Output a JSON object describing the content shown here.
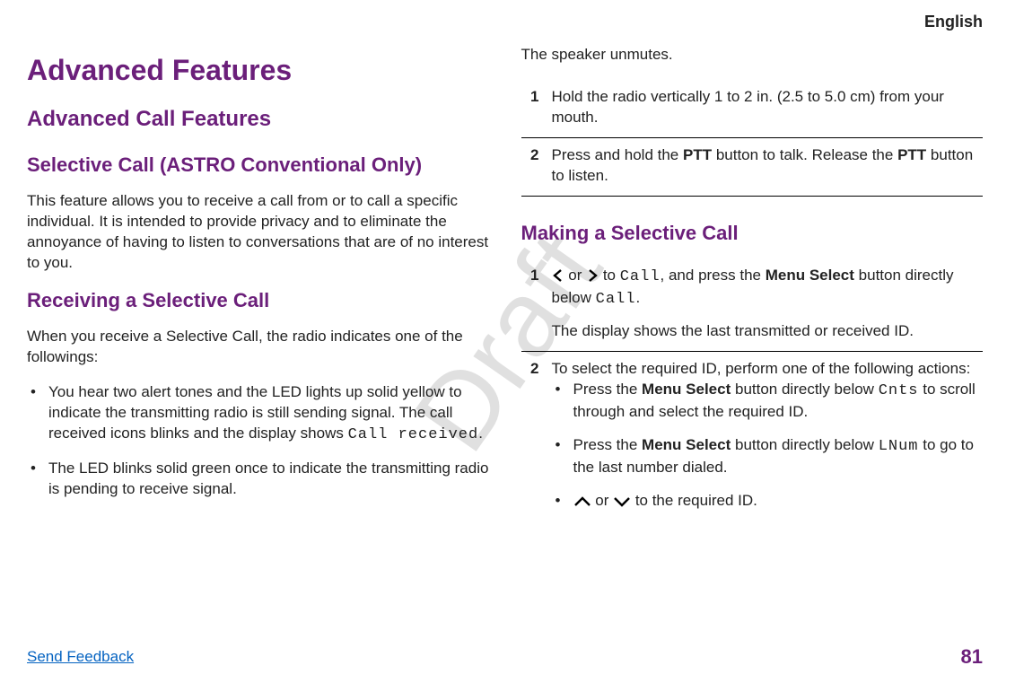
{
  "watermark": "Draft",
  "header": {
    "language": "English"
  },
  "left": {
    "h1": "Advanced Features",
    "h2": "Advanced Call Features",
    "h3a": "Selective Call (ASTRO Conventional Only)",
    "p1": "This feature allows you to receive a call from or to call a specific individual. It is intended to provide privacy and to eliminate the annoyance of having to listen to conversations that are of no interest to you.",
    "h3b": "Receiving a Selective Call",
    "p2": "When you receive a Selective Call, the radio indicates one of the followings:",
    "bullets": [
      {
        "a": "You hear two alert tones and the LED lights up solid yellow to indicate the transmitting radio is still sending signal. The call received icons blinks and the display shows ",
        "mono": "Call received",
        "b": "."
      },
      {
        "a": "The LED blinks solid green once to indicate the transmitting radio is pending to receive signal."
      }
    ]
  },
  "right": {
    "p0": "The speaker unmutes.",
    "stepsA": [
      {
        "num": "1",
        "text": "Hold the radio vertically 1 to 2 in. (2.5 to 5.0 cm) from your mouth."
      },
      {
        "num": "2",
        "a": "Press and hold the ",
        "b1": "PTT",
        "c": " button to talk. Release the ",
        "b2": "PTT",
        "d": " button to listen."
      }
    ],
    "h3": "Making a Selective Call",
    "stepsB": [
      {
        "num": "1",
        "or": " or ",
        "a": " to ",
        "mono1": "Call",
        "b": ", and press the ",
        "bold": "Menu Select",
        "c": " button directly below ",
        "mono2": "Call",
        "d": ".",
        "sub": "The display shows the last transmitted or received ID."
      },
      {
        "num": "2",
        "lead": "To select the required ID, perform one of the following actions:",
        "items": [
          {
            "a": "Press the ",
            "bold": "Menu Select",
            "b": " button directly below ",
            "mono": "Cnts",
            "c": " to scroll through and select the required ID."
          },
          {
            "a": "Press the ",
            "bold": "Menu Select",
            "b": " button directly below ",
            "mono": "LNum",
            "c": " to go to the last number dialed."
          },
          {
            "or": " or ",
            "a": " to the required ID."
          }
        ]
      }
    ]
  },
  "footer": {
    "feedback": "Send Feedback",
    "page": "81"
  }
}
